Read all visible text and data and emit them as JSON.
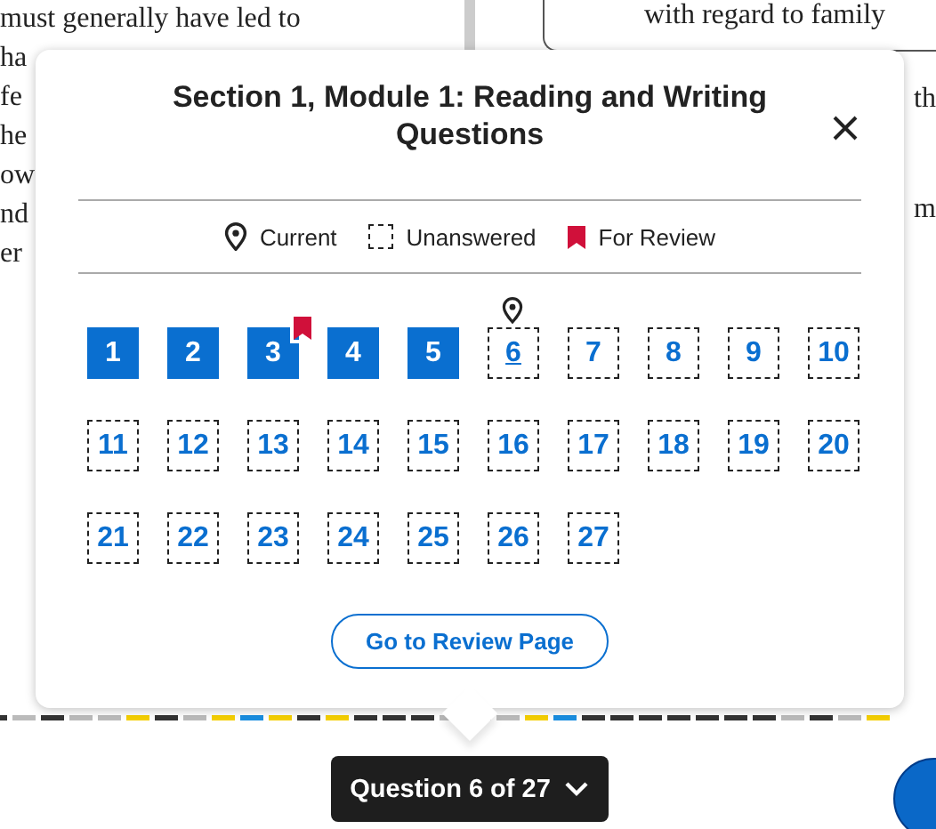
{
  "background": {
    "left_lines": [
      "must generally have led to",
      "ha",
      "fe",
      "he",
      "ow",
      "nd",
      "er"
    ],
    "right_top": "with regard to family",
    "right_lines": [
      "th",
      "m"
    ]
  },
  "popup": {
    "title": "Section 1, Module 1: Reading and Writing Questions",
    "legend": [
      {
        "kind": "current",
        "label": "Current"
      },
      {
        "kind": "unanswered",
        "label": "Unanswered"
      },
      {
        "kind": "review",
        "label": "For Review"
      }
    ],
    "questions": [
      {
        "number": "1",
        "answered": true,
        "current": false,
        "for_review": false
      },
      {
        "number": "2",
        "answered": true,
        "current": false,
        "for_review": false
      },
      {
        "number": "3",
        "answered": true,
        "current": false,
        "for_review": true
      },
      {
        "number": "4",
        "answered": true,
        "current": false,
        "for_review": false
      },
      {
        "number": "5",
        "answered": true,
        "current": false,
        "for_review": false
      },
      {
        "number": "6",
        "answered": false,
        "current": true,
        "for_review": false
      },
      {
        "number": "7",
        "answered": false,
        "current": false,
        "for_review": false
      },
      {
        "number": "8",
        "answered": false,
        "current": false,
        "for_review": false
      },
      {
        "number": "9",
        "answered": false,
        "current": false,
        "for_review": false
      },
      {
        "number": "10",
        "answered": false,
        "current": false,
        "for_review": false
      },
      {
        "number": "11",
        "answered": false,
        "current": false,
        "for_review": false
      },
      {
        "number": "12",
        "answered": false,
        "current": false,
        "for_review": false
      },
      {
        "number": "13",
        "answered": false,
        "current": false,
        "for_review": false
      },
      {
        "number": "14",
        "answered": false,
        "current": false,
        "for_review": false
      },
      {
        "number": "15",
        "answered": false,
        "current": false,
        "for_review": false
      },
      {
        "number": "16",
        "answered": false,
        "current": false,
        "for_review": false
      },
      {
        "number": "17",
        "answered": false,
        "current": false,
        "for_review": false
      },
      {
        "number": "18",
        "answered": false,
        "current": false,
        "for_review": false
      },
      {
        "number": "19",
        "answered": false,
        "current": false,
        "for_review": false
      },
      {
        "number": "20",
        "answered": false,
        "current": false,
        "for_review": false
      },
      {
        "number": "21",
        "answered": false,
        "current": false,
        "for_review": false
      },
      {
        "number": "22",
        "answered": false,
        "current": false,
        "for_review": false
      },
      {
        "number": "23",
        "answered": false,
        "current": false,
        "for_review": false
      },
      {
        "number": "24",
        "answered": false,
        "current": false,
        "for_review": false
      },
      {
        "number": "25",
        "answered": false,
        "current": false,
        "for_review": false
      },
      {
        "number": "26",
        "answered": false,
        "current": false,
        "for_review": false
      },
      {
        "number": "27",
        "answered": false,
        "current": false,
        "for_review": false
      }
    ],
    "review_button": "Go to Review Page"
  },
  "navigator": {
    "label": "Question 6 of 27"
  }
}
